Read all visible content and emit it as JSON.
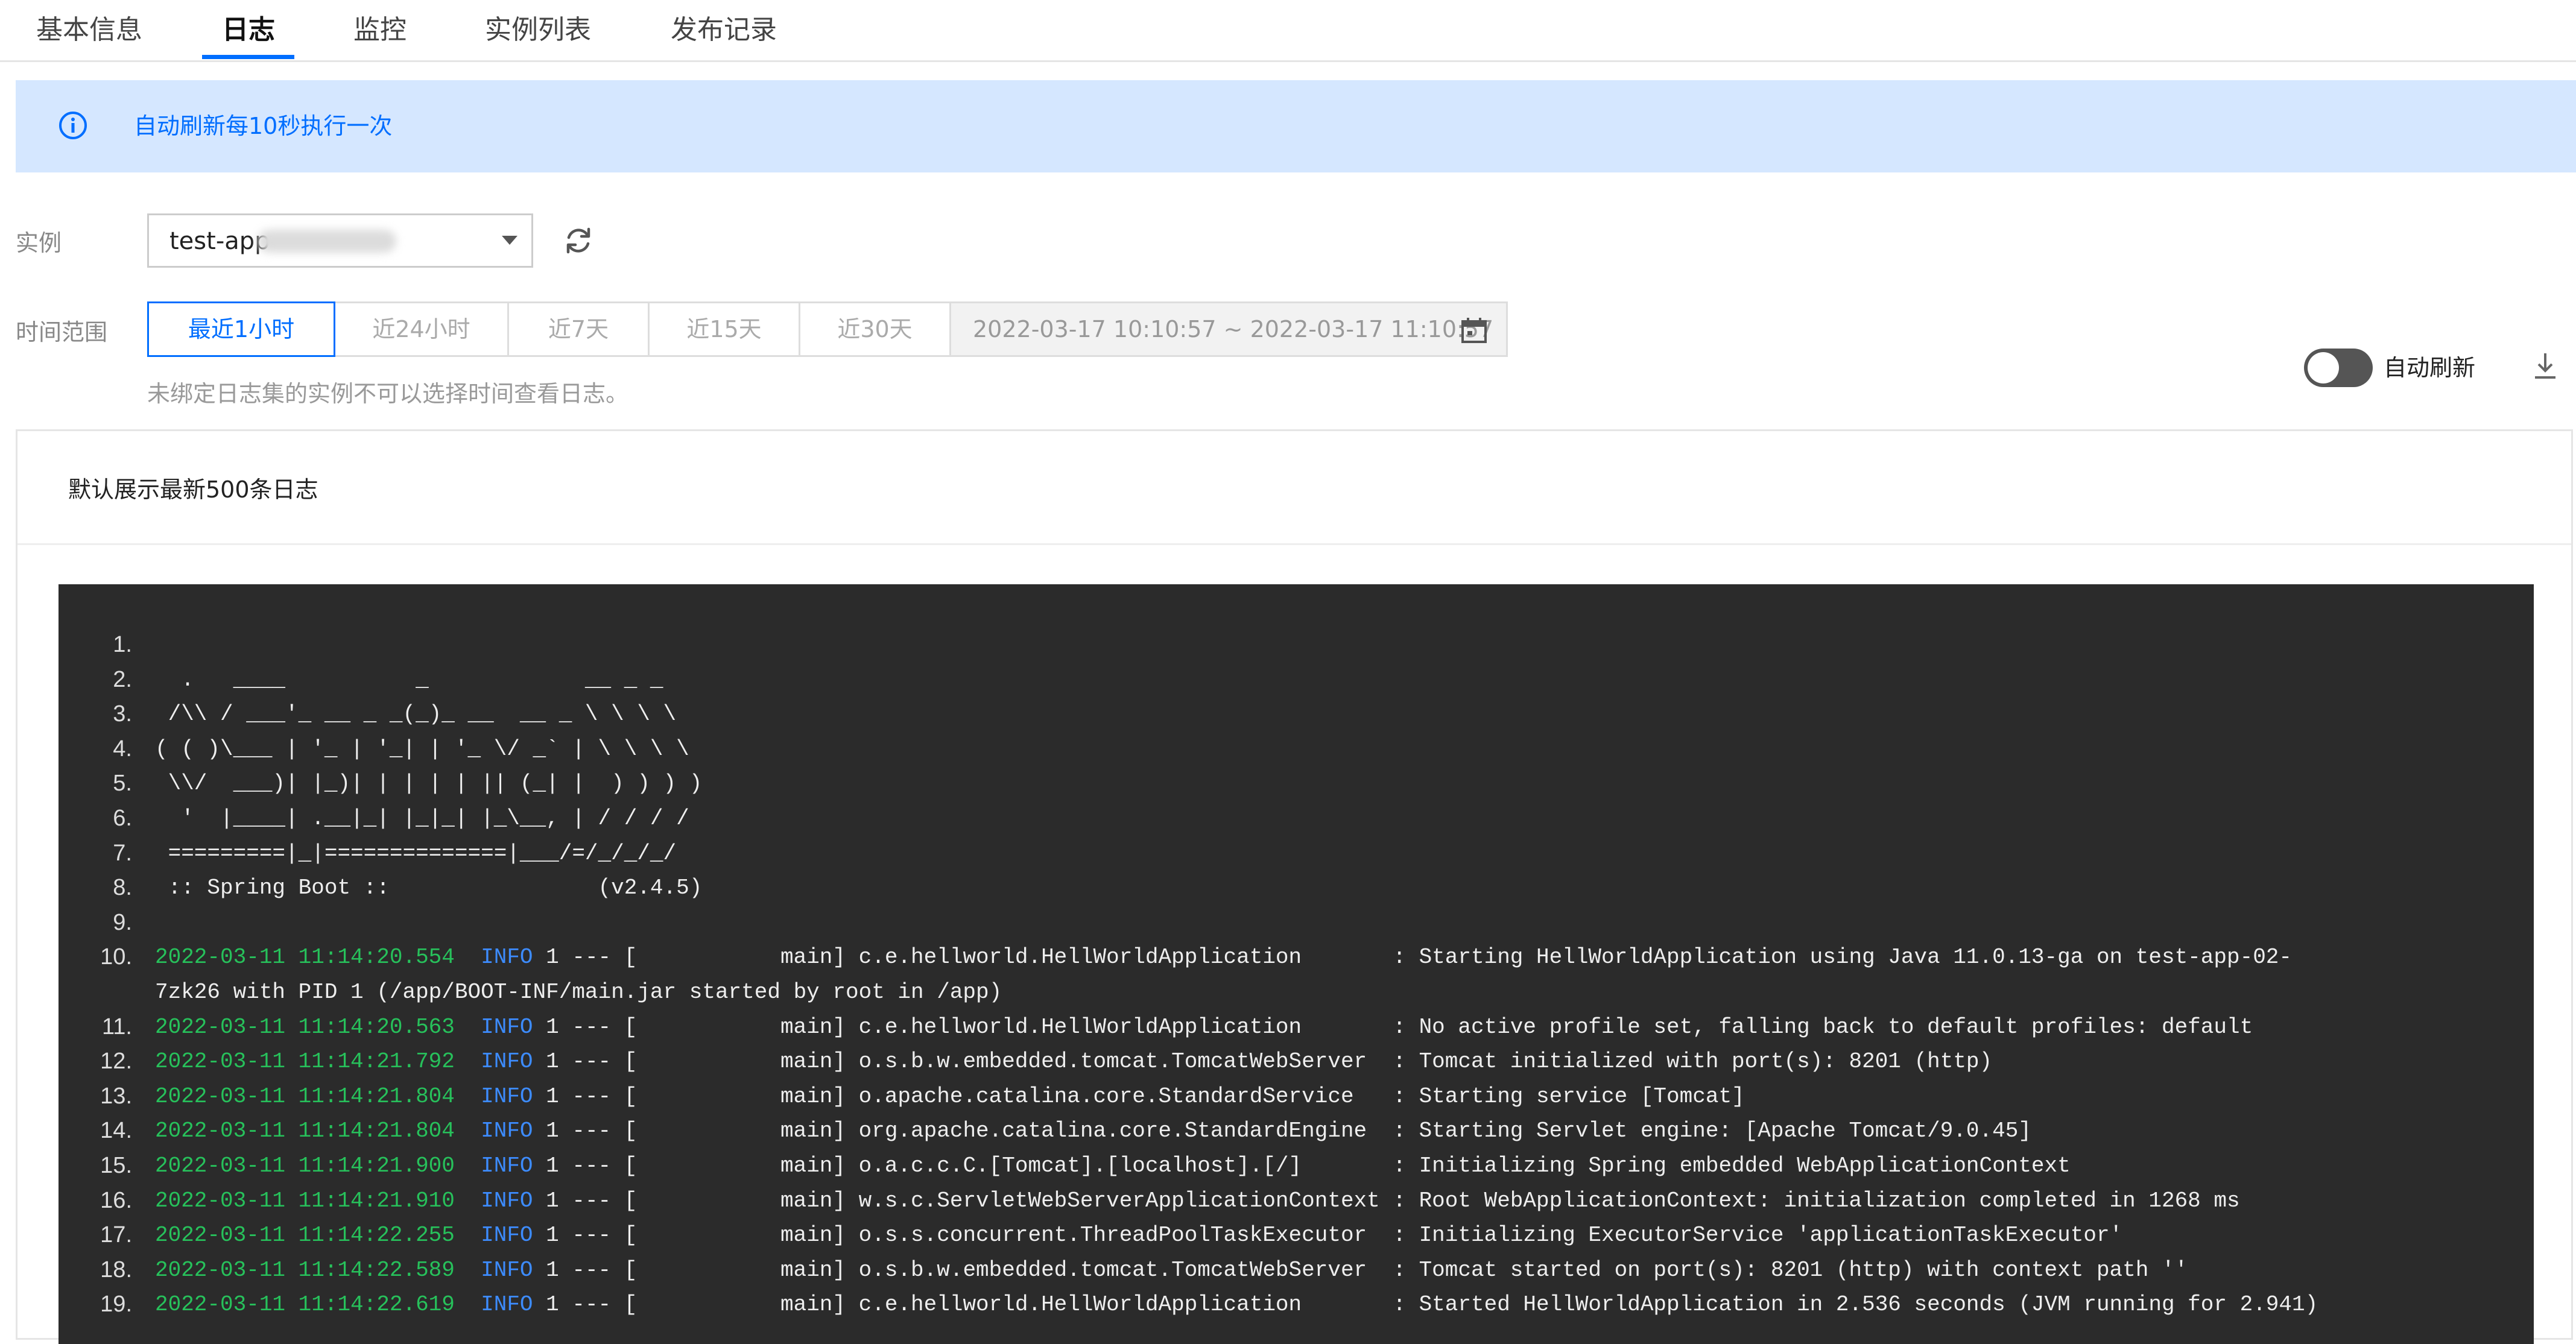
{
  "tabs": [
    {
      "label": "基本信息"
    },
    {
      "label": "日志"
    },
    {
      "label": "监控"
    },
    {
      "label": "实例列表"
    },
    {
      "label": "发布记录"
    }
  ],
  "banner": {
    "text": "自动刷新每10秒执行一次"
  },
  "instance": {
    "label": "实例",
    "value": "test-app-"
  },
  "time_range": {
    "label": "时间范围",
    "options": [
      "最近1小时",
      "近24小时",
      "近7天",
      "近15天",
      "近30天"
    ],
    "selected": "最近1小时",
    "range": "2022-03-17 10:10:57 ~ 2022-03-17 11:10:57",
    "hint": "未绑定日志集的实例不可以选择时间查看日志。"
  },
  "auto_refresh": {
    "label": "自动刷新",
    "enabled": false
  },
  "panel": {
    "title": "默认展示最新500条日志"
  },
  "log": {
    "lines": [
      {
        "n": "1.",
        "text": ""
      },
      {
        "n": "2.",
        "text": "  .   ____          _            __ _ _"
      },
      {
        "n": "3.",
        "text": " /\\\\ / ___'_ __ _ _(_)_ __  __ _ \\ \\ \\ \\"
      },
      {
        "n": "4.",
        "text": "( ( )\\___ | '_ | '_| | '_ \\/ _` | \\ \\ \\ \\"
      },
      {
        "n": "5.",
        "text": " \\\\/  ___)| |_)| | | | | || (_| |  ) ) ) )"
      },
      {
        "n": "6.",
        "text": "  '  |____| .__|_| |_|_| |_\\__, | / / / /"
      },
      {
        "n": "7.",
        "text": " =========|_|==============|___/=/_/_/_/"
      },
      {
        "n": "8.",
        "text": " :: Spring Boot ::                (v2.4.5)"
      },
      {
        "n": "9.",
        "text": ""
      },
      {
        "n": "10.",
        "ts": "2022-03-11 11:14:20.554",
        "lvl": "INFO",
        "rest": " 1 --- [           main] c.e.hellworld.HellWorldApplication       : Starting HellWorldApplication using Java 11.0.13-ga on test-app-02-"
      },
      {
        "n": "",
        "text": "7zk26 with PID 1 (/app/BOOT-INF/main.jar started by root in /app)"
      },
      {
        "n": "11.",
        "ts": "2022-03-11 11:14:20.563",
        "lvl": "INFO",
        "rest": " 1 --- [           main] c.e.hellworld.HellWorldApplication       : No active profile set, falling back to default profiles: default"
      },
      {
        "n": "12.",
        "ts": "2022-03-11 11:14:21.792",
        "lvl": "INFO",
        "rest": " 1 --- [           main] o.s.b.w.embedded.tomcat.TomcatWebServer  : Tomcat initialized with port(s): 8201 (http)"
      },
      {
        "n": "13.",
        "ts": "2022-03-11 11:14:21.804",
        "lvl": "INFO",
        "rest": " 1 --- [           main] o.apache.catalina.core.StandardService   : Starting service [Tomcat]"
      },
      {
        "n": "14.",
        "ts": "2022-03-11 11:14:21.804",
        "lvl": "INFO",
        "rest": " 1 --- [           main] org.apache.catalina.core.StandardEngine  : Starting Servlet engine: [Apache Tomcat/9.0.45]"
      },
      {
        "n": "15.",
        "ts": "2022-03-11 11:14:21.900",
        "lvl": "INFO",
        "rest": " 1 --- [           main] o.a.c.c.C.[Tomcat].[localhost].[/]       : Initializing Spring embedded WebApplicationContext"
      },
      {
        "n": "16.",
        "ts": "2022-03-11 11:14:21.910",
        "lvl": "INFO",
        "rest": " 1 --- [           main] w.s.c.ServletWebServerApplicationContext : Root WebApplicationContext: initialization completed in 1268 ms"
      },
      {
        "n": "17.",
        "ts": "2022-03-11 11:14:22.255",
        "lvl": "INFO",
        "rest": " 1 --- [           main] o.s.s.concurrent.ThreadPoolTaskExecutor  : Initializing ExecutorService 'applicationTaskExecutor'"
      },
      {
        "n": "18.",
        "ts": "2022-03-11 11:14:22.589",
        "lvl": "INFO",
        "rest": " 1 --- [           main] o.s.b.w.embedded.tomcat.TomcatWebServer  : Tomcat started on port(s): 8201 (http) with context path ''"
      },
      {
        "n": "19.",
        "ts": "2022-03-11 11:14:22.619",
        "lvl": "INFO",
        "rest": " 1 --- [           main] c.e.hellworld.HellWorldApplication       : Started HellWorldApplication in 2.536 seconds (JVM running for 2.941)"
      }
    ]
  },
  "icons": {
    "info": "info-icon",
    "refresh": "refresh-icon",
    "calendar": "calendar-icon",
    "download": "download-icon",
    "dropdown": "chevron-down-icon"
  },
  "colors": {
    "accent": "#006eff",
    "banner_bg": "#d5e7ff",
    "terminal_bg": "#2b2b2b",
    "log_timestamp": "#27c15b",
    "log_level": "#3d8cff"
  }
}
